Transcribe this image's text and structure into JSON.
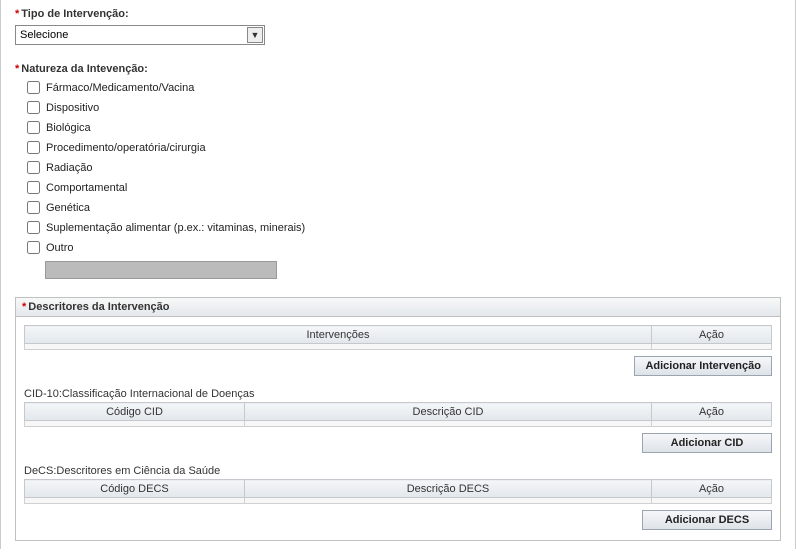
{
  "tipo": {
    "label": "Tipo de Intervenção:",
    "selected": "Selecione"
  },
  "natureza": {
    "label": "Natureza da Intevenção:",
    "options": [
      "Fármaco/Medicamento/Vacina",
      "Dispositivo",
      "Biológica",
      "Procedimento/operatória/cirurgia",
      "Radiação",
      "Comportamental",
      "Genética",
      "Suplementação alimentar (p.ex.: vitaminas, minerais)",
      "Outro"
    ]
  },
  "descritores": {
    "panel_title": "Descritores da Intervenção",
    "intervencoes": {
      "headers": {
        "col1": "Intervenções",
        "col2": "Ação"
      },
      "button": "Adicionar Intervenção"
    },
    "cid": {
      "section": "CID-10:Classificação Internacional de Doenças",
      "headers": {
        "col1": "Código CID",
        "col2": "Descrição CID",
        "col3": "Ação"
      },
      "button": "Adicionar CID"
    },
    "decs": {
      "section": "DeCS:Descritores em Ciência da Saúde",
      "headers": {
        "col1": "Código DECS",
        "col2": "Descrição DECS",
        "col3": "Ação"
      },
      "button": "Adicionar DECS"
    }
  }
}
